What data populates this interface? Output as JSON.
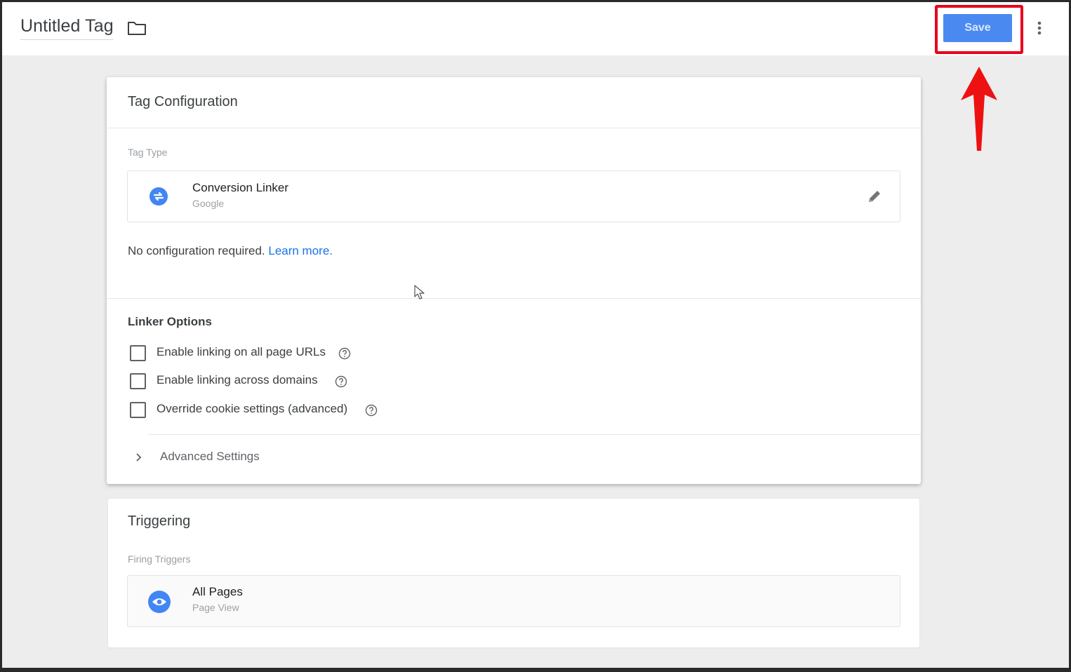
{
  "header": {
    "title": "Untitled Tag",
    "save_label": "Save"
  },
  "tag_configuration": {
    "title": "Tag Configuration",
    "tag_type_label": "Tag Type",
    "tag_type": {
      "name": "Conversion Linker",
      "vendor": "Google"
    },
    "no_config_text": "No configuration required.",
    "learn_more_label": "Learn more.",
    "linker_options": {
      "title": "Linker Options",
      "options": [
        {
          "label": "Enable linking on all page URLs",
          "checked": false
        },
        {
          "label": "Enable linking across domains",
          "checked": false
        },
        {
          "label": "Override cookie settings (advanced)",
          "checked": false
        }
      ]
    },
    "advanced_settings_label": "Advanced Settings"
  },
  "triggering": {
    "title": "Triggering",
    "firing_triggers_label": "Firing Triggers",
    "trigger": {
      "name": "All Pages",
      "type": "Page View"
    }
  },
  "colors": {
    "save_button": "#4a8af0",
    "highlight": "#e8001c",
    "link": "#1a73e8",
    "icon_blue": "#4285f4"
  }
}
